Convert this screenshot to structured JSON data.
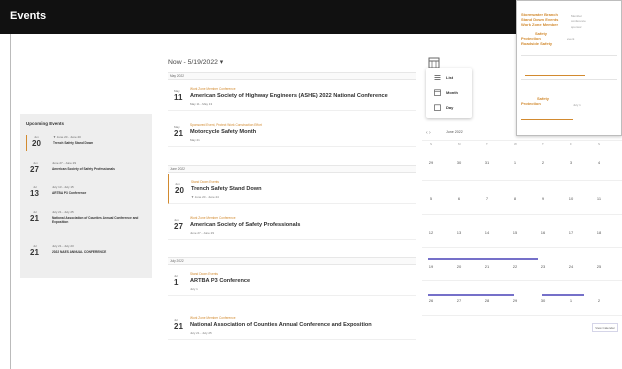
{
  "app": {
    "title": "Events"
  },
  "upcoming": {
    "heading": "Upcoming Events",
    "items": [
      {
        "month": "Jun",
        "day": "20",
        "dates": "▼ June 20 - June 20",
        "name": "Trench Safety Stand Down",
        "active": true
      },
      {
        "month": "Jun",
        "day": "27",
        "dates": "June 27 - June 29",
        "name": "American Society of Safety Professionals",
        "active": false
      },
      {
        "month": "Jul",
        "day": "13",
        "dates": "July 13 - July 15",
        "name": "ARTBA P3 Conference",
        "active": false
      },
      {
        "month": "Jul",
        "day": "21",
        "dates": "July 21 - July 25",
        "name": "National Association of Counties Annual Conference and Exposition",
        "active": false
      },
      {
        "month": "Jul",
        "day": "21",
        "dates": "July 21 - July 23",
        "name": "2022 NAES ANNUAL CONFERENCE",
        "active": false
      }
    ]
  },
  "timeline": {
    "nav": "Now - 5/19/2022 ▾",
    "months": [
      "May 2022",
      "June 2022",
      "July 2022"
    ],
    "events": [
      {
        "month": "May",
        "day": "11",
        "org": "Work Zone Member Conference",
        "name": "American Society of Highway Engineers (ASHE) 2022 National Conference",
        "dates": "May 11 - May 13",
        "active": false
      },
      {
        "month": "May",
        "day": "21",
        "org": "Sponsored Event, Protect Work Construction Effort",
        "name": "Motorcycle Safety Month",
        "dates": "May 21",
        "active": false
      },
      {
        "month": "Jun",
        "day": "20",
        "org": "Stand Down Events",
        "name": "Trench Safety Stand Down",
        "dates": "▼ June 20 - June 24",
        "active": true
      },
      {
        "month": "Jun",
        "day": "27",
        "org": "Work Zone Member Conference",
        "name": "American Society of Safety Professionals",
        "dates": "June 27 - June 29",
        "active": false
      },
      {
        "month": "Jul",
        "day": "1",
        "org": "Stand Down Events",
        "name": "ARTBA P3 Conference",
        "dates": "July 1",
        "active": false
      },
      {
        "month": "Jul",
        "day": "21",
        "org": "Work Zone Member Conference",
        "name": "National Association of Counties Annual Conference and Exposition",
        "dates": "July 21 - July 25",
        "active": false
      }
    ]
  },
  "viewMenu": {
    "options": [
      "List",
      "Month",
      "Day"
    ]
  },
  "calendar": {
    "month": "June 2022",
    "weekdays": [
      "S",
      "M",
      "T",
      "W",
      "T",
      "F",
      "S"
    ],
    "weeks": [
      [
        "29",
        "30",
        "31",
        "1",
        "2",
        "3",
        "4"
      ],
      [
        "5",
        "6",
        "7",
        "8",
        "9",
        "10",
        "11"
      ],
      [
        "12",
        "13",
        "14",
        "15",
        "16",
        "17",
        "18"
      ],
      [
        "19",
        "20",
        "21",
        "22",
        "23",
        "24",
        "25"
      ],
      [
        "26",
        "27",
        "28",
        "29",
        "30",
        "1",
        "2"
      ]
    ],
    "button": "View Calendar"
  },
  "inset": {
    "items": [
      "Stormwater Branch",
      "Stand Down Events",
      "Work Zone Member",
      "Safety",
      "Protection",
      "Roadside Safety",
      "Protection"
    ],
    "notes": [
      "Member",
      "conference",
      "sponsor",
      "event",
      "July 1"
    ]
  },
  "colors": {
    "accent": "#d28a2f",
    "header": "#111111",
    "eventBar": "#7570c9"
  }
}
